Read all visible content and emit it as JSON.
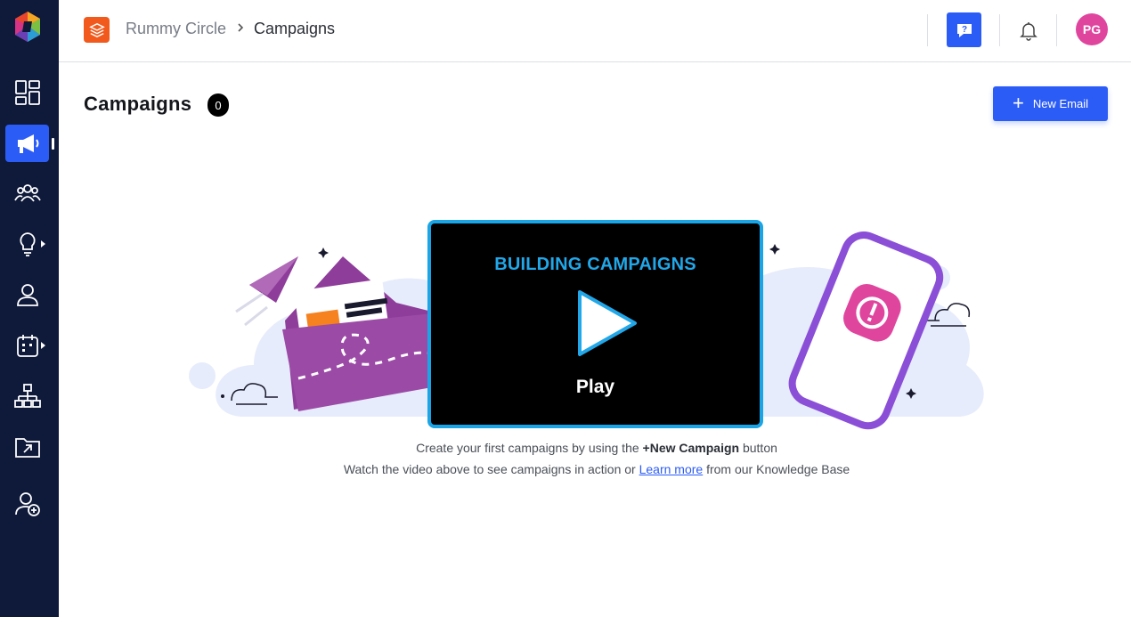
{
  "header": {
    "breadcrumb_parent": "Rummy Circle",
    "breadcrumb_current": "Campaigns",
    "avatar_initials": "PG"
  },
  "page": {
    "title": "Campaigns",
    "count": "0",
    "new_button_label": "New Email"
  },
  "video": {
    "title": "BUILDING CAMPAIGNS",
    "play_label": "Play"
  },
  "empty_state": {
    "line1_prefix": "Create your first campaigns by using the",
    "line1_bold": "+New Campaign",
    "line1_suffix": "button",
    "line2_prefix": "Watch the video above to see campaigns in action or",
    "line2_link": "Learn more",
    "line2_suffix": "from our Knowledge Base"
  },
  "sidebar": {
    "items": [
      {
        "icon": "dashboard-icon"
      },
      {
        "icon": "megaphone-icon",
        "active": true
      },
      {
        "icon": "audience-icon"
      },
      {
        "icon": "lightbulb-icon"
      },
      {
        "icon": "user-icon"
      },
      {
        "icon": "calendar-icon"
      },
      {
        "icon": "sitemap-icon"
      },
      {
        "icon": "export-folder-icon"
      },
      {
        "icon": "add-user-icon"
      }
    ]
  },
  "colors": {
    "sidebar_bg": "#0f1a3b",
    "accent": "#2c5cf6",
    "brand_orange": "#f25a1d",
    "avatar": "#e0459e",
    "video_border": "#1aa5e6"
  }
}
